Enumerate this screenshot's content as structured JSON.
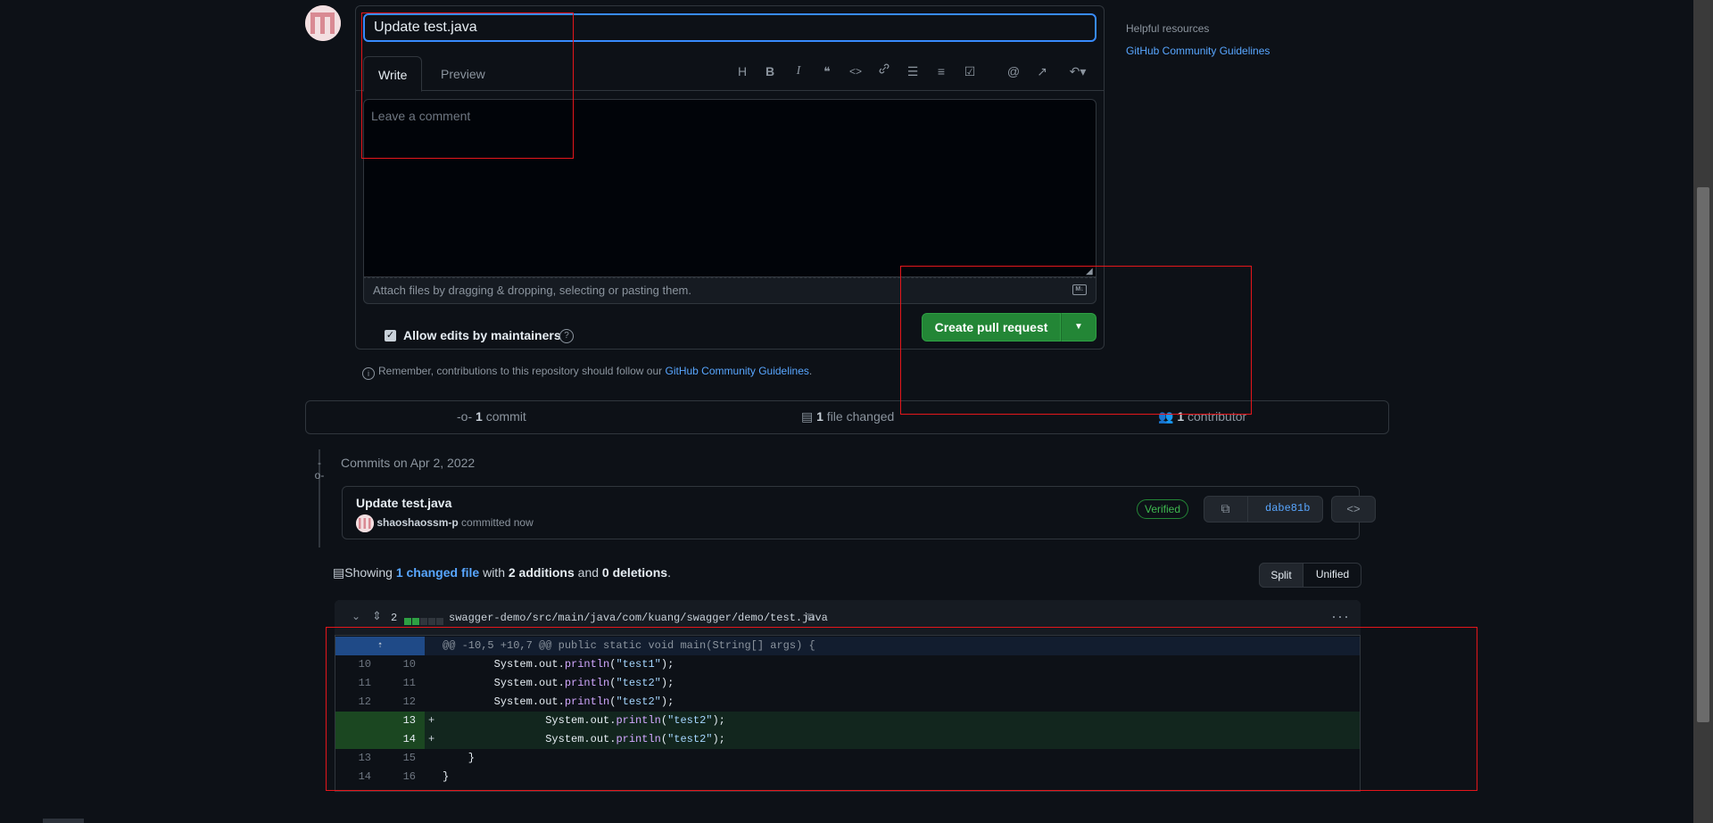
{
  "compose": {
    "title_value": "Update test.java",
    "tabs": [
      {
        "label": "Write"
      },
      {
        "label": "Preview"
      }
    ],
    "toolbar": [
      {
        "icon": "heading-icon",
        "glyph": "H"
      },
      {
        "icon": "bold-icon",
        "glyph": "B"
      },
      {
        "icon": "italic-icon",
        "glyph": "I"
      },
      {
        "icon": "quote-icon",
        "glyph": "❝"
      },
      {
        "icon": "code-icon",
        "glyph": "<>"
      },
      {
        "icon": "link-icon",
        "glyph": "🔗"
      },
      {
        "icon": "bullet-list-icon",
        "glyph": "☰"
      },
      {
        "icon": "numbered-list-icon",
        "glyph": "≡"
      },
      {
        "icon": "task-list-icon",
        "glyph": "☑"
      },
      {
        "icon": "mention-icon",
        "glyph": "@"
      },
      {
        "icon": "reference-icon",
        "glyph": "↗"
      },
      {
        "icon": "reply-icon",
        "glyph": "↶▾"
      }
    ],
    "comment_placeholder": "Leave a comment",
    "attach_text": "Attach files by dragging & dropping, selecting or pasting them.",
    "markdown_icon_glyph": "M↓",
    "allow_edits_label": "Allow edits by maintainers",
    "allow_edits_checked": true,
    "create_button": "Create pull request",
    "reminder_prefix": "Remember, contributions to this repository should follow our ",
    "reminder_link": "GitHub Community Guidelines",
    "reminder_suffix": "."
  },
  "sidebar": {
    "heading": "Helpful resources",
    "link": "GitHub Community Guidelines"
  },
  "stats": {
    "commits_count": "1",
    "commits_label": " commit",
    "files_count": "1",
    "files_label": " file changed",
    "contributors_count": "1",
    "contributors_label": " contributor"
  },
  "commits": {
    "date_heading": "Commits on Apr 2, 2022",
    "items": [
      {
        "title": "Update test.java",
        "author": "shaoshaossm-p",
        "when": " committed now",
        "badge": "Verified",
        "sha": "dabe81b"
      }
    ]
  },
  "summary": {
    "prefix": "Showing ",
    "changed_link": "1 changed file",
    "middle": " with ",
    "additions": "2 additions",
    "and": " and ",
    "deletions": "0 deletions",
    "suffix": ".",
    "view_modes": [
      "Split",
      "Unified"
    ]
  },
  "diff": {
    "file_count": "2",
    "file_path": "swagger-demo/src/main/java/com/kuang/swagger/demo/test.java",
    "hunk_header": "@@ -10,5 +10,7 @@ public static void main(String[] args) {",
    "lines": [
      {
        "old": "10",
        "new": "10",
        "type": "context",
        "code": "        System.out.println(\"test1\");"
      },
      {
        "old": "11",
        "new": "11",
        "type": "context",
        "code": "        System.out.println(\"test2\");"
      },
      {
        "old": "12",
        "new": "12",
        "type": "context",
        "code": "        System.out.println(\"test2\");"
      },
      {
        "old": "",
        "new": "13",
        "type": "add",
        "code": "                System.out.println(\"test2\");"
      },
      {
        "old": "",
        "new": "14",
        "type": "add",
        "code": "                System.out.println(\"test2\");"
      },
      {
        "old": "13",
        "new": "15",
        "type": "context",
        "code": "    }"
      },
      {
        "old": "14",
        "new": "16",
        "type": "context",
        "code": "}"
      }
    ]
  },
  "colors": {
    "accent": "#58a6ff",
    "success": "#238636",
    "annotation": "#e5161b"
  }
}
